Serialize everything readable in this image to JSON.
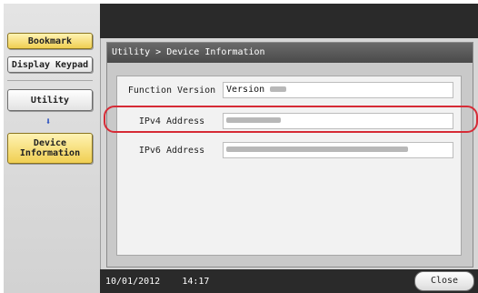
{
  "sidebar": {
    "bookmark_label": "Bookmark",
    "display_keypad_label": "Display Keypad",
    "utility_label": "Utility",
    "arrow": "⬇",
    "device_info_label": "Device\nInformation"
  },
  "window": {
    "title": "Utility > Device Information"
  },
  "info_rows": [
    {
      "label": "Function Version",
      "value": "Version"
    },
    {
      "label": "IPv4 Address",
      "value": ""
    },
    {
      "label": "IPv6 Address",
      "value": ""
    }
  ],
  "footer": {
    "date": "10/01/2012",
    "time": "14:17",
    "close_label": "Close"
  },
  "colors": {
    "highlight": "#d62b36",
    "selected_button": "#f0cf52"
  }
}
